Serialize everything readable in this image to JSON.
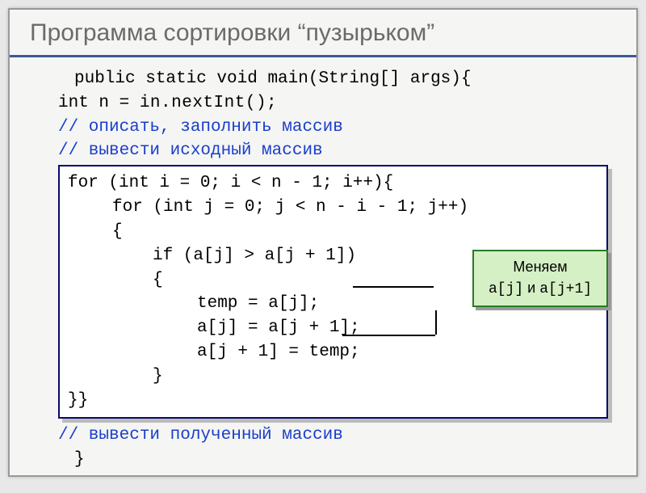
{
  "title": "Программа сортировки “пузырьком”",
  "code": {
    "l1": "public static void main(String[] args){",
    "l2_a": "int n = ",
    "l2_b": "in.nextInt();",
    "c1": "// описать, заполнить массив",
    "c2": "// вывести исходный массив",
    "box": {
      "b1": "for (int i = 0; i < n - 1; i++){",
      "b2": "for (int j = 0; j < n - i - 1; j++)",
      "b3": "{",
      "b4": "if (a[j] > a[j + 1])",
      "b5": "{",
      "b6": "temp = a[j];",
      "b7": "a[j] = a[j + 1];",
      "b8": "a[j + 1] = temp;",
      "b9": "}",
      "b10": "}}"
    },
    "c3": "// вывести полученный массив",
    "l_end": "}"
  },
  "callout": {
    "line1": "Меняем",
    "line2_a": "a[j]",
    "line2_mid": " и ",
    "line2_b": "a[j+1]"
  }
}
